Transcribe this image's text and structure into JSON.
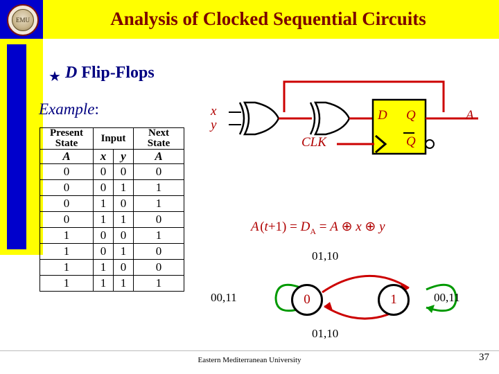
{
  "header": {
    "title": "Analysis of Clocked Sequential Circuits",
    "logo_text": "EMU",
    "logo_icon": "university-seal-icon"
  },
  "headings": {
    "bullet_glyph": "★",
    "section": "D Flip-Flops",
    "section_italic_part": "D",
    "example_label": "Example",
    "example_colon": ":"
  },
  "table": {
    "header_row_1": [
      "Present State",
      "Input",
      "Next State"
    ],
    "header_present_line1": "Present",
    "header_present_line2": "State",
    "header_input": "Input",
    "header_next_line1": "Next",
    "header_next_line2": "State",
    "header_row_2": [
      "A",
      "x",
      "y",
      "A"
    ],
    "rows": [
      [
        "0",
        "0",
        "0",
        "0"
      ],
      [
        "0",
        "0",
        "1",
        "1"
      ],
      [
        "0",
        "1",
        "0",
        "1"
      ],
      [
        "0",
        "1",
        "1",
        "0"
      ],
      [
        "1",
        "0",
        "0",
        "1"
      ],
      [
        "1",
        "0",
        "1",
        "0"
      ],
      [
        "1",
        "1",
        "0",
        "0"
      ],
      [
        "1",
        "1",
        "1",
        "1"
      ]
    ]
  },
  "circuit": {
    "input_x": "x",
    "input_y": "y",
    "clock": "CLK",
    "ff_d": "D",
    "ff_q": "Q",
    "ff_qbar": "Q",
    "output_a": "A",
    "xor_gate_1": "xor-gate-icon",
    "xor_gate_2": "xor-gate-icon",
    "flipflop": "d-flip-flop-icon"
  },
  "equation": {
    "text": "A (t+1) = D",
    "subscript": "A",
    "rest": " = A ⊕ x ⊕ y"
  },
  "state_diagram": {
    "state_0": "0",
    "state_1": "1",
    "label_top": "01,10",
    "label_bottom": "01,10",
    "label_left": "00,11",
    "label_right": "00,11"
  },
  "footer": {
    "institution": "Eastern Mediterranean University",
    "page_number": "37"
  },
  "colors": {
    "header_bg": "#FFFF00",
    "header_title": "#7B0000",
    "heading_blue": "#000080",
    "data_red": "#B00000",
    "bar_blue": "#0000CC",
    "wire_red": "#CC0000",
    "wire_green": "#009900"
  }
}
